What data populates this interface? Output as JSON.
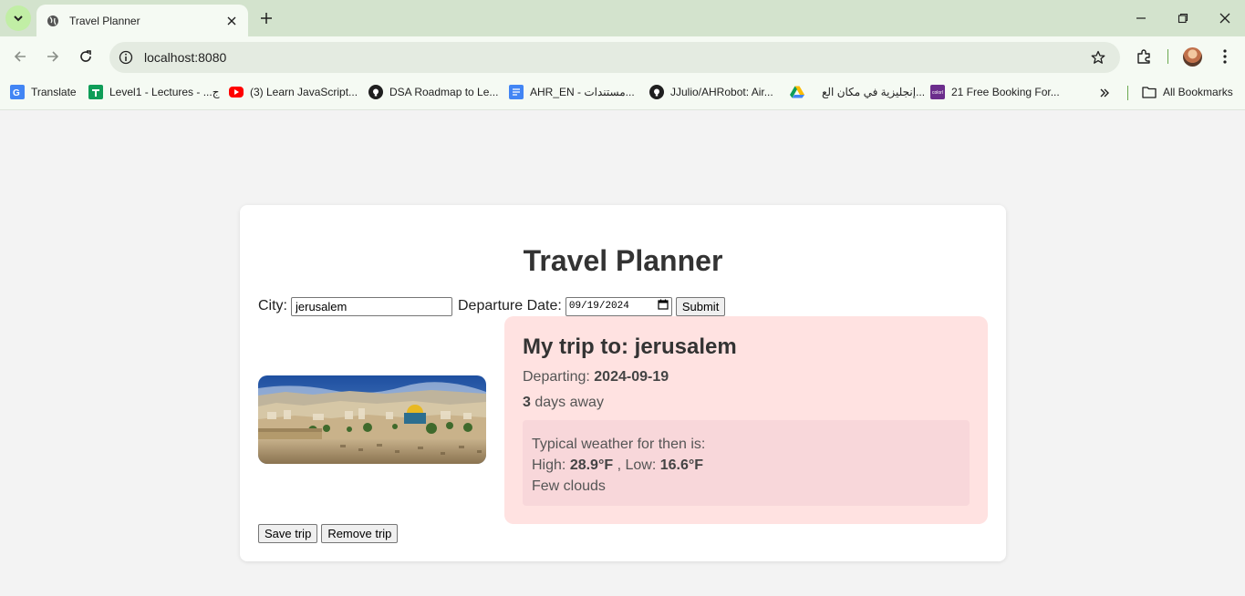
{
  "browser": {
    "tab_title": "Travel Planner",
    "url": "localhost:8080",
    "bookmarks": [
      {
        "label": "Translate",
        "icon": "google-translate-icon"
      },
      {
        "label": "Level1 - Lectures - ...ج",
        "icon": "google-sheets-icon"
      },
      {
        "label": "(3) Learn JavaScript...",
        "icon": "youtube-icon"
      },
      {
        "label": "DSA Roadmap to Le...",
        "icon": "github-icon"
      },
      {
        "label": "AHR_EN - مستندات...",
        "icon": "google-docs-icon"
      },
      {
        "label": "JJulio/AHRobot: Air...",
        "icon": "github-icon"
      },
      {
        "label": "إنجليزية في مكان الع...",
        "icon": "google-drive-icon"
      },
      {
        "label": "21 Free Booking For...",
        "icon": "colorlib-icon"
      }
    ],
    "all_bookmarks_label": "All Bookmarks"
  },
  "page": {
    "title": "Travel Planner",
    "form": {
      "city_label": "City:",
      "city_value": "jerusalem",
      "date_label": "Departure Date:",
      "date_value": "09/19/2024",
      "submit_label": "Submit"
    },
    "trip": {
      "heading": "My trip to: jerusalem",
      "departing_label": "Departing:",
      "departing_value": "2024-09-19",
      "days_value": "3",
      "days_suffix": "days away",
      "weather": {
        "intro": "Typical weather for then is:",
        "high_label": "High:",
        "high_value": "28.9°F",
        "low_label": ", Low:",
        "low_value": "16.6°F",
        "description": "Few clouds"
      }
    },
    "save_label": "Save trip",
    "remove_label": "Remove trip"
  },
  "colors": {
    "chrome_tabbar": "#d3e3cd",
    "chrome_toolbar": "#f5faf3",
    "page_bg": "#f3f3f3",
    "trip_panel": "#ffe2e1",
    "weather_box": "#f8d7da"
  }
}
